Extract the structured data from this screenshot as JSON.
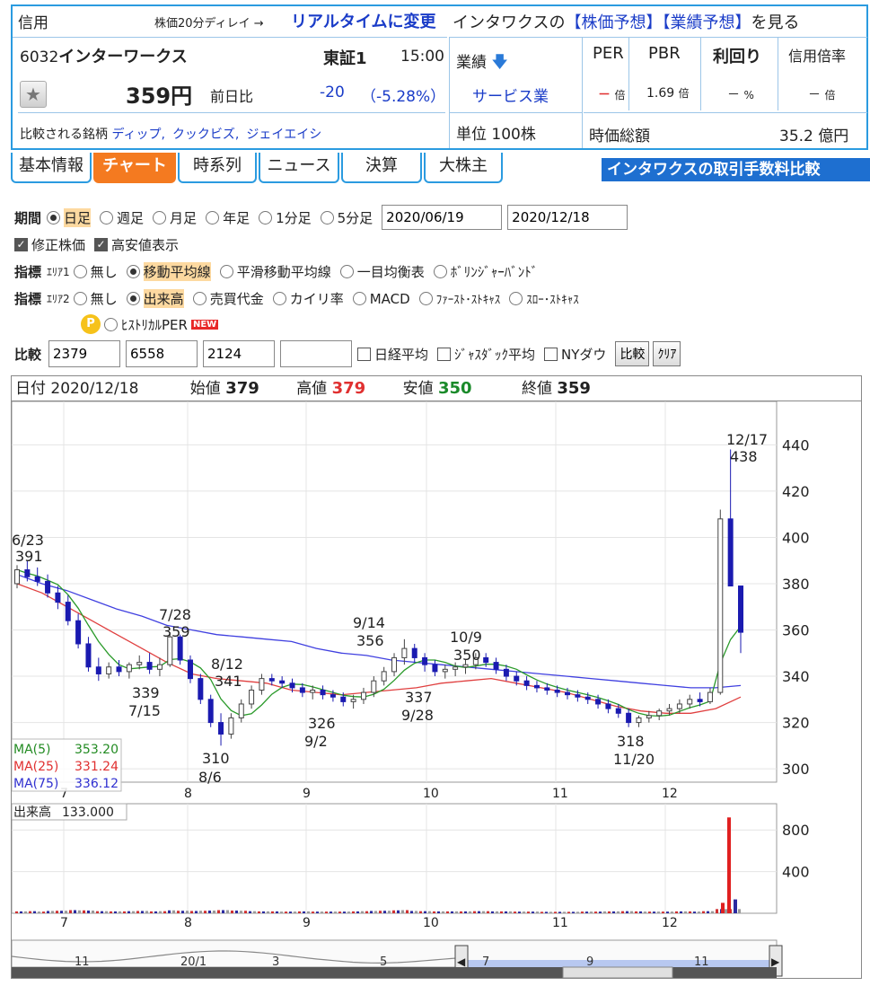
{
  "header": {
    "shinyo": "信用",
    "delay_note": "株価20分ディレイ →",
    "realtime_link": "リアルタイムに変更",
    "yoso_prefix": "インタワクスの",
    "kabuka_yoso": "【株価予想】",
    "gyoseki_yoso": "【業績予想】",
    "yoso_suffix": "を見る",
    "code": "6032",
    "name": "インターワークス",
    "market": "東証1",
    "time": "15:00",
    "price": "359円",
    "zenjitsu_label": "前日比",
    "change": "-20",
    "change_pct": "（-5.28%）",
    "compare_label": "比較される銘柄",
    "compare_links": [
      "ディップ,",
      "クックビズ,",
      "ジェイエイシ"
    ],
    "gyoseki_label": "業績",
    "sector": "サービス業",
    "unit": "単位 100株",
    "metrics": [
      {
        "head": "PER",
        "val": "－",
        "unit": "倍"
      },
      {
        "head": "PBR",
        "val": "1.69",
        "unit": "倍"
      },
      {
        "head": "利回り",
        "val": "－",
        "unit": "%"
      },
      {
        "head": "信用倍率",
        "val": "－",
        "unit": "倍"
      }
    ],
    "mktcap_label": "時価総額",
    "mktcap_value": "35.2 億円"
  },
  "tabs": [
    "基本情報",
    "チャート",
    "時系列",
    "ニュース",
    "決算",
    "大株主"
  ],
  "active_tab": "チャート",
  "banner": "インタワクスの取引手数料比較",
  "controls": {
    "period_label": "期間",
    "period_options": [
      "日足",
      "週足",
      "月足",
      "年足",
      "1分足",
      "5分足"
    ],
    "date_from": "2020/06/19",
    "date_to": "2020/12/18",
    "check_adjusted": "修正株価",
    "check_highlow": "高安値表示",
    "indicator_label": "指標",
    "area1": "ｴﾘｱ1",
    "area1_options": [
      "無し",
      "移動平均線",
      "平滑移動平均線",
      "一目均衡表",
      "ﾎﾞﾘﾝｼﾞｬｰﾊﾞﾝﾄﾞ"
    ],
    "area2": "ｴﾘｱ2",
    "area2_options": [
      "無し",
      "出来高",
      "売買代金",
      "カイリ率",
      "MACD",
      "ﾌｧｰｽﾄ･ｽﾄｷｬｽ",
      "ｽﾛｰ･ｽﾄｷｬｽ"
    ],
    "coin": "P",
    "historical_per": "ﾋｽﾄﾘｶﾙPER",
    "new_badge": "NEW",
    "compare_label": "比較",
    "compare_codes": [
      "2379",
      "6558",
      "2124",
      ""
    ],
    "compare_checks": [
      "日経平均",
      "ｼﾞｬｽﾀﾞｯｸ平均",
      "NYダウ"
    ],
    "btn_compare": "比較",
    "btn_clear": "ｸﾘｱ"
  },
  "ohlc": {
    "date_label": "日付",
    "date": "2020/12/18",
    "open_label": "始値",
    "open": "379",
    "high_label": "高値",
    "high": "379",
    "low_label": "安値",
    "low": "350",
    "close_label": "終値",
    "close": "359"
  },
  "chart_data": {
    "type": "candlestick",
    "y_ticks": [
      300,
      320,
      340,
      360,
      380,
      400,
      420,
      440
    ],
    "ylim": [
      295,
      458
    ],
    "x_month_labels": [
      "7",
      "8",
      "9",
      "10",
      "11",
      "12"
    ],
    "annotations": [
      {
        "date": "6/23",
        "value": "391"
      },
      {
        "date": "7/28",
        "value": "359"
      },
      {
        "date": "8/12",
        "value": "341"
      },
      {
        "date": "9/14",
        "value": "356"
      },
      {
        "date": "10/9",
        "value": "350"
      },
      {
        "date": "12/17",
        "value": "438"
      },
      {
        "date": "7/15",
        "value": "339"
      },
      {
        "date": "8/6",
        "value": "310"
      },
      {
        "date": "9/2",
        "value": "326"
      },
      {
        "date": "9/28",
        "value": "337"
      },
      {
        "date": "11/20",
        "value": "318"
      }
    ],
    "ma_legend": [
      {
        "name": "MA(5)",
        "value": "353.20",
        "color": "#228b22"
      },
      {
        "name": "MA(25)",
        "value": "331.24",
        "color": "#e03030"
      },
      {
        "name": "MA(75)",
        "value": "336.12",
        "color": "#3030d0"
      }
    ],
    "ma25": [
      380,
      376,
      370,
      364,
      358,
      352,
      346,
      341,
      339,
      338,
      337,
      334,
      333,
      332,
      333,
      334,
      335,
      337,
      338,
      339,
      337,
      335,
      333,
      330,
      327,
      325,
      324,
      324,
      326,
      331
    ],
    "ma75": [
      384,
      380,
      377,
      373,
      369,
      366,
      362,
      360,
      358,
      357,
      356,
      355,
      352,
      350,
      349,
      347,
      346,
      345,
      344,
      343,
      342,
      341,
      340,
      339,
      338,
      337,
      336,
      335,
      335,
      336
    ],
    "candles": [
      [
        380,
        388,
        378,
        386
      ],
      [
        386,
        390,
        381,
        383
      ],
      [
        383,
        387,
        379,
        381
      ],
      [
        381,
        384,
        374,
        376
      ],
      [
        376,
        379,
        369,
        372
      ],
      [
        372,
        375,
        362,
        364
      ],
      [
        364,
        367,
        352,
        354
      ],
      [
        354,
        357,
        342,
        344
      ],
      [
        344,
        348,
        338,
        341
      ],
      [
        341,
        346,
        339,
        344
      ],
      [
        344,
        347,
        340,
        342
      ],
      [
        342,
        346,
        339,
        345
      ],
      [
        345,
        349,
        343,
        346
      ],
      [
        346,
        350,
        341,
        343
      ],
      [
        343,
        348,
        340,
        345
      ],
      [
        345,
        359,
        344,
        357
      ],
      [
        357,
        358,
        345,
        347
      ],
      [
        347,
        349,
        337,
        339
      ],
      [
        339,
        341,
        328,
        330
      ],
      [
        330,
        332,
        318,
        320
      ],
      [
        320,
        324,
        310,
        315
      ],
      [
        315,
        324,
        313,
        322
      ],
      [
        322,
        330,
        320,
        328
      ],
      [
        328,
        336,
        326,
        334
      ],
      [
        334,
        341,
        332,
        339
      ],
      [
        339,
        341,
        336,
        338
      ],
      [
        338,
        340,
        335,
        337
      ],
      [
        337,
        339,
        333,
        335
      ],
      [
        335,
        337,
        331,
        333
      ],
      [
        333,
        336,
        330,
        334
      ],
      [
        334,
        336,
        330,
        332
      ],
      [
        332,
        334,
        329,
        331
      ],
      [
        331,
        333,
        327,
        329
      ],
      [
        329,
        332,
        326,
        330
      ],
      [
        330,
        335,
        328,
        333
      ],
      [
        333,
        340,
        331,
        338
      ],
      [
        338,
        344,
        336,
        342
      ],
      [
        342,
        350,
        340,
        348
      ],
      [
        348,
        356,
        345,
        352
      ],
      [
        352,
        354,
        346,
        348
      ],
      [
        348,
        350,
        342,
        345
      ],
      [
        345,
        347,
        340,
        342
      ],
      [
        342,
        345,
        339,
        343
      ],
      [
        343,
        346,
        340,
        344
      ],
      [
        344,
        347,
        341,
        345
      ],
      [
        345,
        350,
        343,
        348
      ],
      [
        348,
        350,
        344,
        346
      ],
      [
        346,
        348,
        341,
        343
      ],
      [
        343,
        345,
        338,
        340
      ],
      [
        340,
        342,
        336,
        338
      ],
      [
        338,
        340,
        334,
        336
      ],
      [
        336,
        338,
        333,
        335
      ],
      [
        335,
        337,
        332,
        334
      ],
      [
        334,
        336,
        331,
        333
      ],
      [
        333,
        335,
        330,
        332
      ],
      [
        332,
        334,
        329,
        331
      ],
      [
        331,
        333,
        328,
        330
      ],
      [
        330,
        332,
        326,
        328
      ],
      [
        328,
        330,
        324,
        326
      ],
      [
        326,
        328,
        322,
        324
      ],
      [
        324,
        326,
        318,
        320
      ],
      [
        320,
        323,
        318,
        322
      ],
      [
        322,
        325,
        320,
        323
      ],
      [
        323,
        326,
        321,
        325
      ],
      [
        325,
        328,
        323,
        326
      ],
      [
        326,
        330,
        324,
        328
      ],
      [
        328,
        332,
        326,
        330
      ],
      [
        330,
        333,
        327,
        329
      ],
      [
        329,
        335,
        328,
        333
      ],
      [
        333,
        412,
        332,
        408
      ],
      [
        408,
        438,
        384,
        379
      ],
      [
        379,
        379,
        350,
        359
      ]
    ],
    "volume": [
      18,
      20,
      16,
      22,
      24,
      30,
      28,
      26,
      20,
      18,
      18,
      20,
      22,
      18,
      20,
      28,
      24,
      22,
      24,
      26,
      30,
      26,
      24,
      20,
      18,
      18,
      16,
      16,
      18,
      16,
      16,
      16,
      16,
      18,
      20,
      22,
      24,
      28,
      30,
      22,
      20,
      18,
      18,
      18,
      18,
      20,
      20,
      18,
      18,
      16,
      16,
      16,
      14,
      14,
      14,
      14,
      16,
      16,
      18,
      18,
      20,
      18,
      16,
      16,
      16,
      18,
      18,
      16,
      20,
      100,
      920,
      133
    ],
    "volume_axis": [
      400,
      800
    ],
    "volume_legend": {
      "name": "出来高",
      "value": "133.000"
    },
    "nav_labels": [
      "11",
      "20/1",
      "3",
      "5",
      "7",
      "9",
      "11"
    ]
  }
}
